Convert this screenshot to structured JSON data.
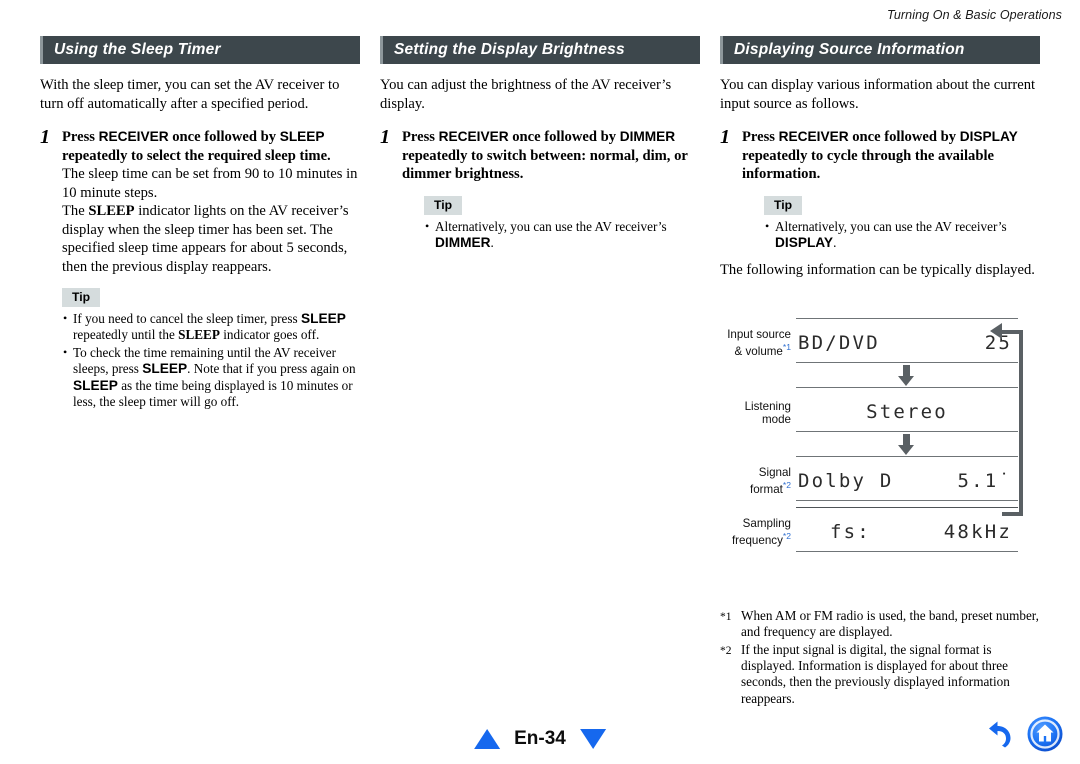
{
  "header": {
    "running_title": "Turning On & Basic Operations"
  },
  "columns": [
    {
      "section_title": "Using the Sleep Timer",
      "intro": "With the sleep timer, you can set the AV receiver to turn off automatically after a specified period.",
      "step": {
        "number": "1",
        "head_1": "Press ",
        "head_key1": "RECEIVER",
        "head_2": " once followed by ",
        "head_key2": "SLEEP",
        "head_3": "repeatedly to select the required sleep time.",
        "body_1": "The sleep time can be set from 90 to 10 minutes in 10 minute steps.",
        "body_2a": "The ",
        "body_key": "SLEEP",
        "body_2b": " indicator lights on the AV receiver’s display when the sleep timer has been set. The specified sleep time appears for about 5 seconds, then the previous display reappears."
      },
      "tip": {
        "label": "Tip",
        "items": [
          {
            "p1": "If you need to cancel the sleep timer, press ",
            "k1": "SLEEP",
            "p2": " repeatedly until the ",
            "k2": "SLEEP",
            "p3": " indicator goes off."
          },
          {
            "p1": "To check the time remaining until the AV receiver sleeps, press ",
            "k1": "SLEEP",
            "p2": ". Note that if you press again on ",
            "k2": "SLEEP",
            "p3": " as the time being displayed is 10 minutes or less, the sleep timer will go off."
          }
        ]
      }
    },
    {
      "section_title": "Setting the Display Brightness",
      "intro": "You can adjust the brightness of the AV receiver’s display.",
      "step": {
        "number": "1",
        "head_1": "Press ",
        "head_key1": "RECEIVER",
        "head_2": " once followed by ",
        "head_key2": "DIMMER",
        "head_3": "repeatedly to switch between: normal, dim, or dimmer brightness."
      },
      "tip": {
        "label": "Tip",
        "item": {
          "p1": "Alternatively, you can use the AV receiver’s ",
          "k1": "DIMMER",
          "p2": "."
        }
      }
    },
    {
      "section_title": "Displaying Source Information",
      "intro": "You can display various information about the current input source as follows.",
      "step": {
        "number": "1",
        "head_1": "Press ",
        "head_key1": "RECEIVER",
        "head_2": " once followed by ",
        "head_key2": "DISPLAY",
        "head_3": "repeatedly to cycle through the available information."
      },
      "tip": {
        "label": "Tip",
        "item": {
          "p1": "Alternatively, you can use the AV receiver’s ",
          "k1": "DISPLAY",
          "p2": "."
        }
      },
      "diagram_intro": "The following information can be typically displayed.",
      "diagram": {
        "rows": [
          {
            "label_line1": "Input source",
            "label_line2": "& volume",
            "footnote_mark": "*1",
            "lcd_left": "BD/DVD",
            "lcd_right": "25"
          },
          {
            "label_line1": "Listening",
            "label_line2": "mode",
            "footnote_mark": "",
            "lcd_center": "Stereo"
          },
          {
            "label_line1": "Signal",
            "label_line2": "format",
            "footnote_mark": "*2",
            "lcd_left": "Dolby D",
            "lcd_right": "5.1˙"
          },
          {
            "label_line1": "Sampling",
            "label_line2": "frequency",
            "footnote_mark": "*2",
            "lcd_left": "fs:",
            "lcd_right": "48kHz"
          }
        ]
      },
      "footnotes": [
        {
          "mark": "*1",
          "text": "When AM or FM radio is used, the band, preset number, and frequency are displayed."
        },
        {
          "mark": "*2",
          "text": "If the input signal is digital, the signal format is displayed. Information is displayed for about three seconds, then the previously displayed information reappears."
        }
      ]
    }
  ],
  "footer": {
    "page_label": "En-34",
    "prev_icon": "triangle-up-icon",
    "next_icon": "triangle-down-icon",
    "back_icon": "back-arrow-icon",
    "home_icon": "home-icon",
    "accent_color": "#1668ee"
  }
}
